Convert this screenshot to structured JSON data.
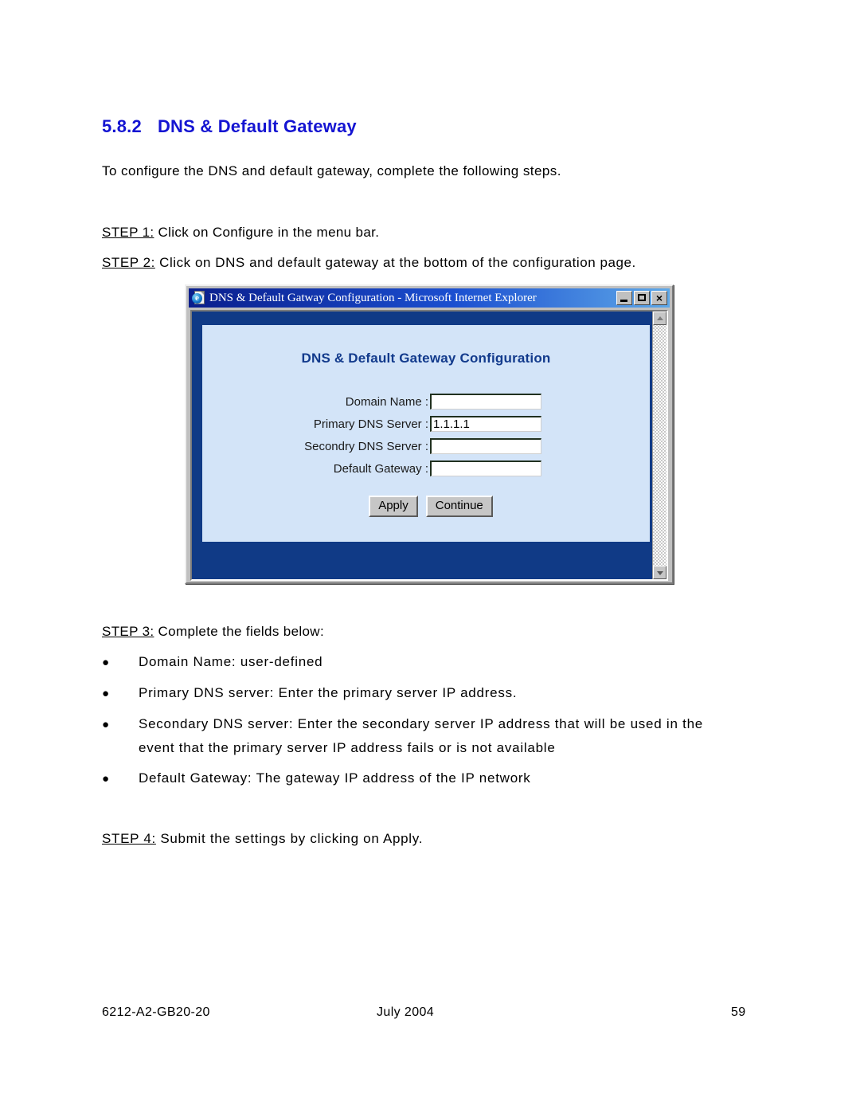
{
  "document": {
    "section_number": "5.8.2",
    "section_title": "DNS & Default Gateway",
    "intro": "To configure the DNS and default gateway, complete the following steps.",
    "steps": [
      {
        "label": "STEP 1:",
        "text": " Click on Configure in the menu bar."
      },
      {
        "label": "STEP 2:",
        "text": " Click on DNS and default gateway at the bottom of the configuration page."
      },
      {
        "label": "STEP 3:",
        "text": " Complete the fields below:"
      },
      {
        "label": "STEP 4:",
        "text": "  Submit the settings by clicking on Apply."
      }
    ],
    "bullets": [
      "Domain Name: user-defined",
      "Primary DNS server: Enter the primary server IP address.",
      "Secondary DNS server: Enter the secondary server IP address that will be used in the",
      "event that the primary server IP address fails or is not available",
      "Default Gateway: The gateway IP address of the IP network"
    ],
    "bullet_marker": "●"
  },
  "footer": {
    "doc_id": "6212-A2-GB20-20",
    "date": "July 2004",
    "page_number": "59"
  },
  "browser_window": {
    "title": "DNS & Default Gatway Configuration - Microsoft Internet Explorer",
    "icon": "internet-explorer-document-icon",
    "window_buttons": {
      "minimize": "_",
      "maximize": "□",
      "close": "×"
    },
    "scrollbar": {
      "up_arrow": "▲",
      "down_arrow": "▼"
    },
    "page": {
      "heading": "DNS & Default Gateway Configuration",
      "fields": [
        {
          "label": "Domain Name :",
          "value": ""
        },
        {
          "label": "Primary DNS Server :",
          "value": "1.1.1.1"
        },
        {
          "label": "Secondry DNS Server :",
          "value": ""
        },
        {
          "label": "Default Gateway :",
          "value": ""
        }
      ],
      "buttons": [
        {
          "label": "Apply"
        },
        {
          "label": "Continue"
        }
      ]
    }
  },
  "colors": {
    "heading_blue": "#1414d2",
    "panel_bg": "#d3e4f8",
    "page_bg_navy": "#103a86",
    "panel_title": "#123a8c",
    "chrome_gray": "#c0c0c0"
  }
}
